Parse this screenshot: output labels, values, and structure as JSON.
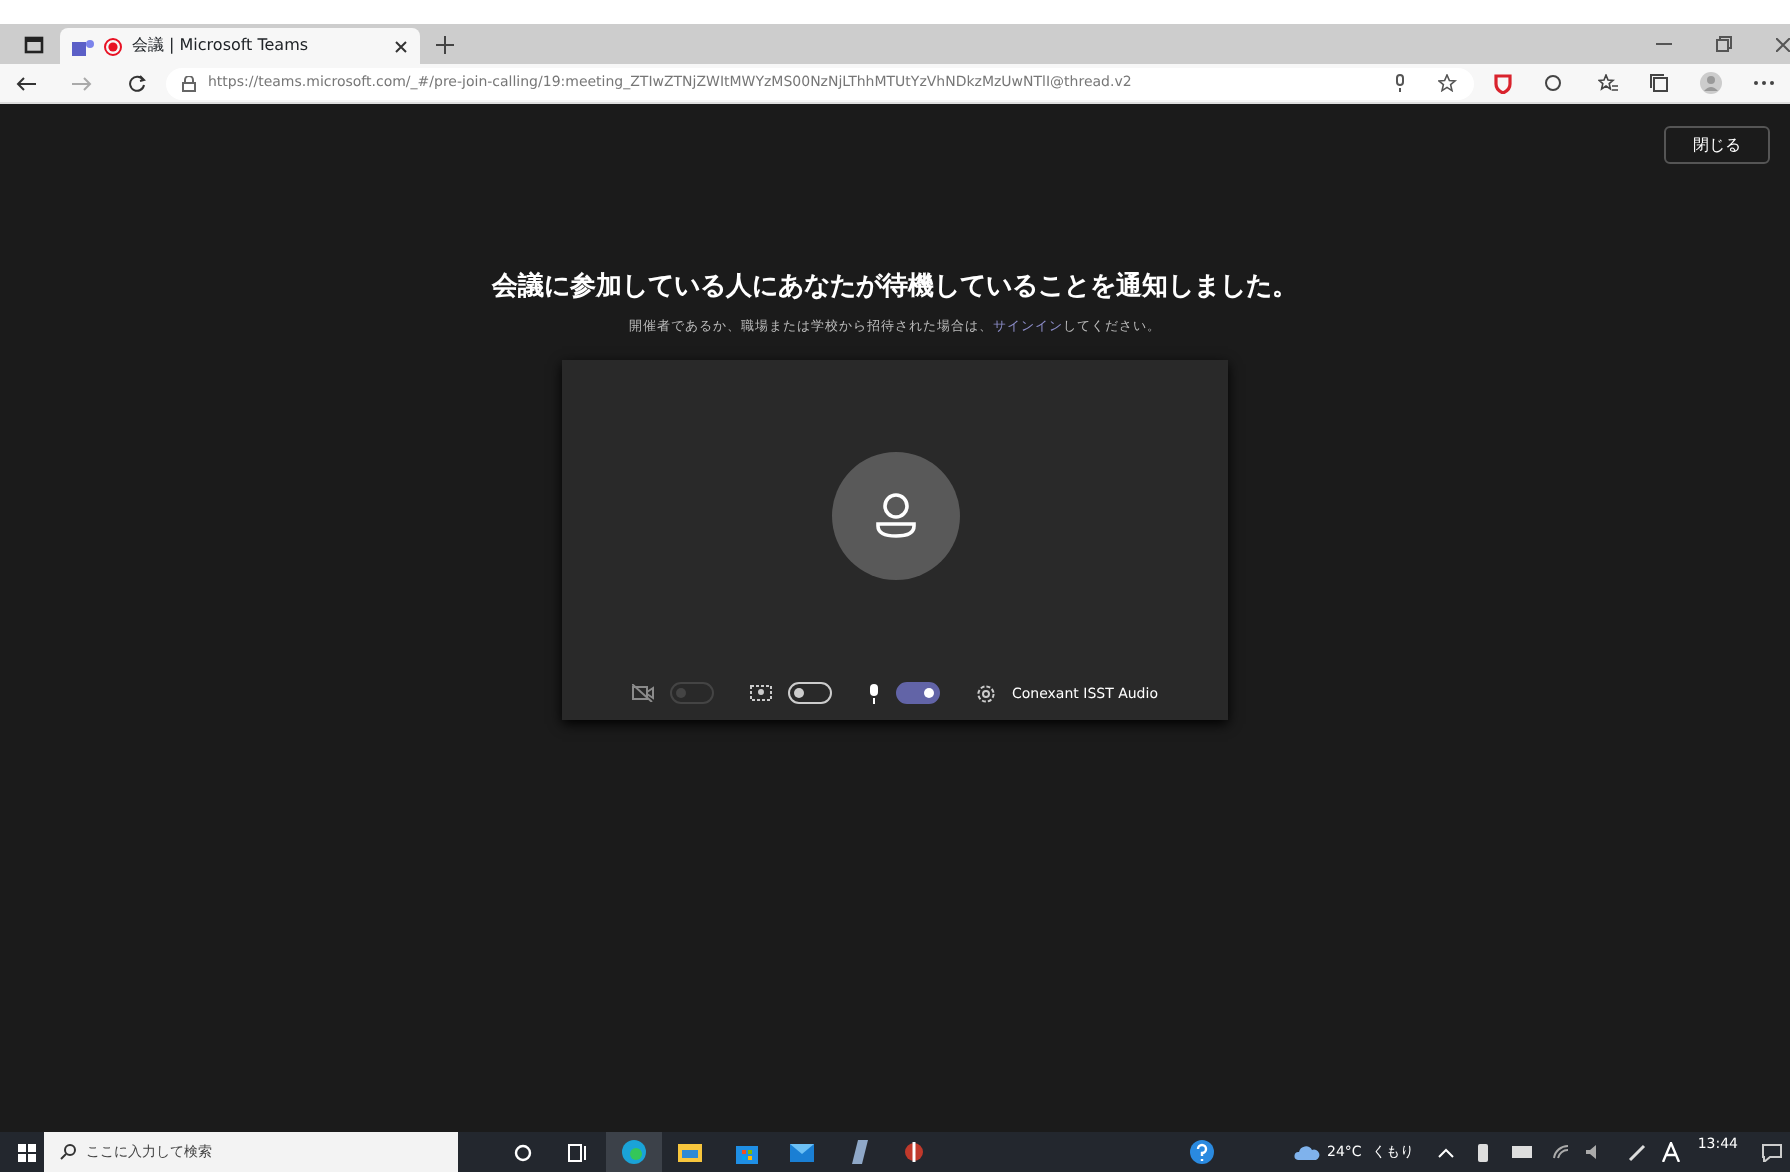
{
  "browser": {
    "tab": {
      "title": "会議 | Microsoft Teams",
      "selected": true
    },
    "url": "https://teams.microsoft.com/_#/pre-join-calling/19:meeting_ZTIwZTNjZWItMWYzMS00NzNjLThhMTUtYzVhNDkzMzUwNTlI@thread.v2"
  },
  "page": {
    "close_button": "閉じる",
    "heading": "会議に参加している人にあなたが待機していることを通知しました。",
    "subtitle": {
      "before": "開催者であるか、職場または学校から招待された場合は、",
      "link": "サインイン",
      "after": "してください。"
    },
    "controls": [
      {
        "kind": "camera",
        "on": false,
        "disabled": true
      },
      {
        "kind": "blur",
        "on": false,
        "disabled": false
      },
      {
        "kind": "mic",
        "on": true,
        "disabled": false
      }
    ],
    "device": "Conexant ISST Audio"
  },
  "taskbar": {
    "search_placeholder": "ここに入力して検索",
    "temperature": "24°C",
    "weather": "くもり",
    "time": "13:44"
  }
}
